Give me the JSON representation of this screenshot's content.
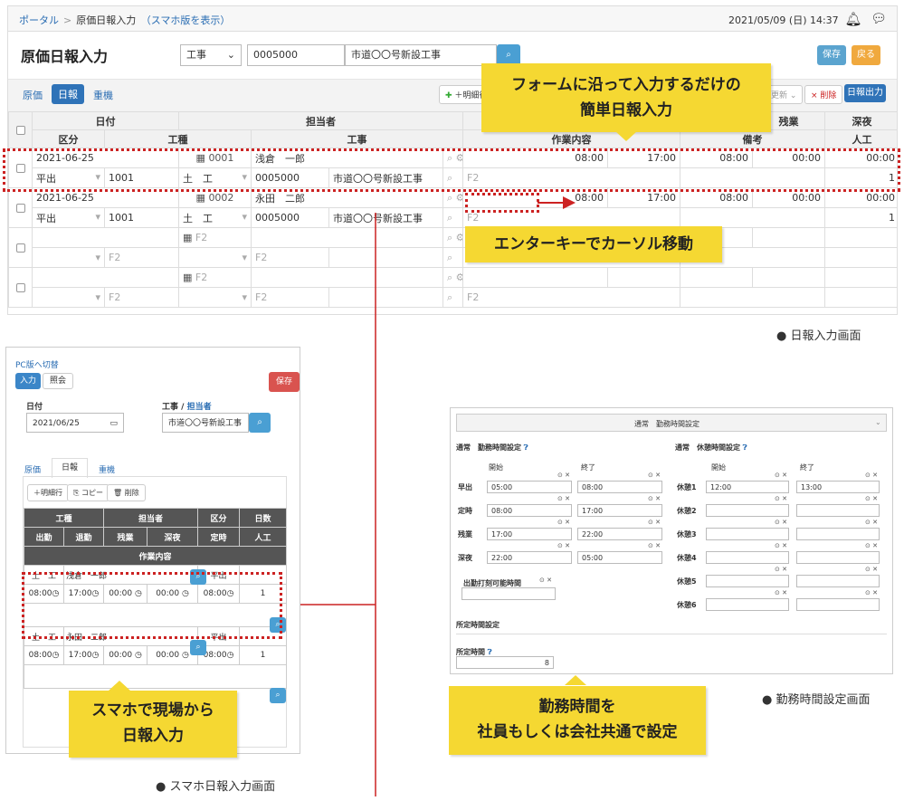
{
  "pc": {
    "breadcrumb": {
      "portal": "ポータル",
      "current": "原価日報入力",
      "mobile_link": "（スマホ版を表示）"
    },
    "datetime": "2021/05/09 (日) 14:37",
    "title": "原価日報入力",
    "filter": {
      "type": "工事",
      "code": "0005000",
      "name": "市道〇〇号新設工事"
    },
    "buttons": {
      "save": "保存",
      "back": "戻る",
      "add_row": "＋明細行",
      "update": "更新",
      "delete": "× 削除",
      "print": "日報出力"
    },
    "tabs": [
      "原価",
      "日報",
      "重機"
    ],
    "headers": {
      "row1": [
        "日付",
        "担当者",
        "残業",
        "深夜"
      ],
      "row2": [
        "区分",
        "工種",
        "工事",
        "作業内容",
        "備考",
        "人工"
      ]
    },
    "rows": [
      {
        "date": "2021-06-25",
        "kind": "平出",
        "kosu": "1001",
        "kosu_name": "土　工",
        "staff_code": "0001",
        "staff_name": "浅倉　一郎",
        "project_code": "0005000",
        "project_name": "市道〇〇号新設工事",
        "start": "08:00",
        "end": "17:00",
        "f2": "F2",
        "overtime": "08:00",
        "late": "00:00",
        "night": "00:00",
        "man_days": "1"
      },
      {
        "date": "2021-06-25",
        "kind": "平出",
        "kosu": "1001",
        "kosu_name": "土　工",
        "staff_code": "0002",
        "staff_name": "永田　二郎",
        "project_code": "0005000",
        "project_name": "市道〇〇号新設工事",
        "start": "08:00",
        "end": "17:00",
        "f2": "F2",
        "overtime": "08:00",
        "late": "00:00",
        "night": "00:00",
        "man_days": "1"
      }
    ],
    "placeholder": "F2"
  },
  "callouts": {
    "form_line1": "フォームに沿って入力するだけの",
    "form_line2": "簡単日報入力",
    "enter": "エンターキーでカーソル移動",
    "mobile_line1": "スマホで現場から",
    "mobile_line2": "日報入力",
    "work_line1": "勤務時間を",
    "work_line2": "社員もしくは会社共通で設定"
  },
  "captions": {
    "pc": "日報入力画面",
    "mobile": "スマホ日報入力画面",
    "work": "勤務時間設定画面"
  },
  "mobile": {
    "switch": "PC版へ切替",
    "mode_input": "入力",
    "mode_view": "照会",
    "save": "保存",
    "date_label": "日付",
    "date_value": "2021/06/25",
    "project_label": "工事 / ",
    "staff_label": "担当者",
    "project_value": "市道〇〇号新設工事",
    "tabs": [
      "原価",
      "日報",
      "重機"
    ],
    "buttons": {
      "add": "＋明細行",
      "copy": "コピー",
      "delete": "削除"
    },
    "head1": [
      "工種",
      "担当者",
      "区分",
      "日数"
    ],
    "head2": [
      "出勤",
      "退勤",
      "残業",
      "深夜",
      "定時",
      "人工"
    ],
    "head3": "作業内容",
    "rows": [
      {
        "kosu": "土　工",
        "staff": "浅倉　一郎",
        "kind": "平出",
        "start": "08:00",
        "end": "17:00",
        "ot": "00:00",
        "night": "00:00",
        "reg": "08:00",
        "man": "1"
      },
      {
        "kosu": "土　工",
        "staff": "永田　二郎",
        "kind": "平出",
        "start": "08:00",
        "end": "17:00",
        "ot": "00:00",
        "night": "00:00",
        "reg": "08:00",
        "man": "1"
      }
    ]
  },
  "worktime": {
    "header": "通常　勤務時間設定",
    "left_title": "通常　勤務時間設定",
    "right_title": "通常　休憩時間設定",
    "col_start": "開始",
    "col_end": "終了",
    "work_rows": [
      {
        "label": "早出",
        "start": "05:00",
        "end": "08:00"
      },
      {
        "label": "定時",
        "start": "08:00",
        "end": "17:00"
      },
      {
        "label": "残業",
        "start": "17:00",
        "end": "22:00"
      },
      {
        "label": "深夜",
        "start": "22:00",
        "end": "05:00"
      }
    ],
    "break_rows": [
      {
        "label": "休憩1",
        "start": "12:00",
        "end": "13:00"
      },
      {
        "label": "休憩2",
        "start": "",
        "end": ""
      },
      {
        "label": "休憩3",
        "start": "",
        "end": ""
      },
      {
        "label": "休憩4",
        "start": "",
        "end": ""
      },
      {
        "label": "休憩5",
        "start": "",
        "end": ""
      },
      {
        "label": "休憩6",
        "start": "",
        "end": ""
      }
    ],
    "punch_label": "出勤打刻可能時間",
    "fixed_section": "所定時間設定",
    "fixed_label": "所定時間",
    "fixed_value": "8"
  }
}
